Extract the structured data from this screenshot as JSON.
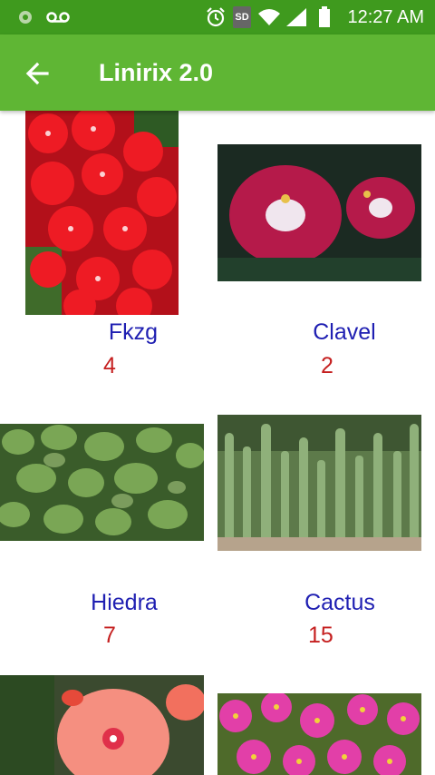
{
  "status_bar": {
    "time": "12:27 AM",
    "sd_label": "SD",
    "icons": [
      "notification-dot-icon",
      "voicemail-icon",
      "alarm-icon",
      "sd-card-icon",
      "wifi-icon",
      "cell-signal-icon",
      "battery-icon"
    ]
  },
  "app_bar": {
    "title": "Linirix 2.0",
    "back_icon": "arrow-back-icon"
  },
  "plants": [
    {
      "name": "Fkzg",
      "count": "4"
    },
    {
      "name": "Clavel",
      "count": "2"
    },
    {
      "name": "Hiedra",
      "count": "7"
    },
    {
      "name": "Cactus",
      "count": "15"
    },
    {
      "name": "",
      "count": ""
    },
    {
      "name": "",
      "count": ""
    }
  ],
  "colors": {
    "status_bar": "#3f9a1e",
    "app_bar": "#5fb634",
    "name_text": "#1f1fb2",
    "count_text": "#c51f1f"
  }
}
